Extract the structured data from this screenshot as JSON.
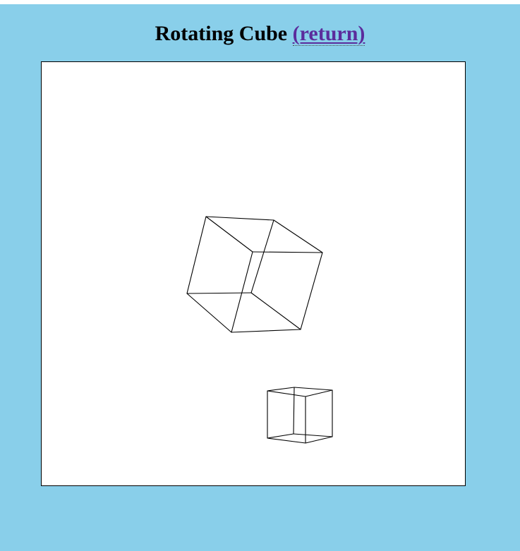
{
  "header": {
    "title": "Rotating Cube",
    "return_link": "(return)"
  },
  "colors": {
    "page_background": "#89CFEA",
    "canvas_background": "#ffffff",
    "link": "#5B2C9C",
    "wireframe_stroke": "#000000"
  },
  "canvas": {
    "cubes": [
      {
        "name": "large-cube"
      },
      {
        "name": "small-cube"
      }
    ]
  }
}
